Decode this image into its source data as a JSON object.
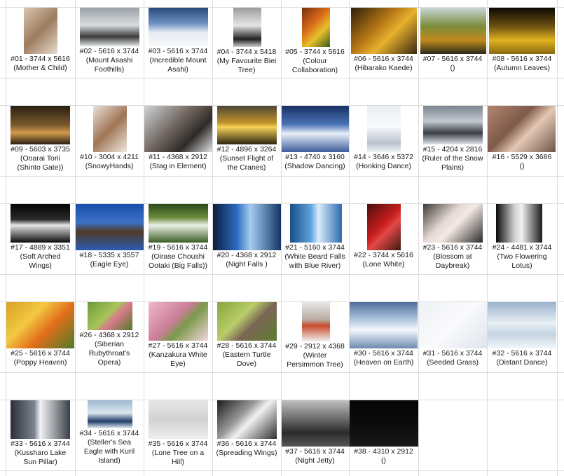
{
  "photos": [
    {
      "id": "01",
      "line1": "#01 - 3744 x 5616",
      "line2": "(Mother & Child)",
      "line3": "",
      "thumb": "photo-thumbnail-mother-child"
    },
    {
      "id": "02",
      "line1": "#02 - 5616 x 3744",
      "line2": "(Mount Asashi",
      "line3": "Foothills)",
      "thumb": "photo-thumbnail-mount-asashi-foothills"
    },
    {
      "id": "03",
      "line1": "#03 - 5616 x 3744",
      "line2": "(Incredible Mount",
      "line3": "Asahi)",
      "thumb": "photo-thumbnail-incredible-mount-asahi"
    },
    {
      "id": "04",
      "line1": "#04 - 3744 x 5418",
      "line2": "(My Favourite Biei",
      "line3": "Tree)",
      "thumb": "photo-thumbnail-biei-tree"
    },
    {
      "id": "05",
      "line1": "#05 - 3744 x 5616",
      "line2": "(Colour",
      "line3": "Collaboration)",
      "thumb": "photo-thumbnail-colour-collaboration"
    },
    {
      "id": "06",
      "line1": "#06 - 5616 x 3744",
      "line2": "(Hibarako Kaede)",
      "line3": "",
      "thumb": "photo-thumbnail-hibarako-kaede"
    },
    {
      "id": "07",
      "line1": "#07 - 5616 x 3744",
      "line2": "()",
      "line3": "",
      "thumb": "photo-thumbnail-07"
    },
    {
      "id": "08",
      "line1": "#08 - 5616 x 3744",
      "line2": "(Autumn Leaves)",
      "line3": "",
      "thumb": "photo-thumbnail-autumn-leaves"
    },
    {
      "id": "09",
      "line1": "#09 - 5603 x 3735",
      "line2": "(Ooarai Torii",
      "line3": "(Shinto Gate))",
      "thumb": "photo-thumbnail-ooarai-torii"
    },
    {
      "id": "10",
      "line1": "#10 - 3004 x 4211",
      "line2": "(SnowyHands)",
      "line3": "",
      "thumb": "photo-thumbnail-snowy-hands"
    },
    {
      "id": "11",
      "line1": "#11 - 4368 x 2912",
      "line2": "(Stag in Element)",
      "line3": "",
      "thumb": "photo-thumbnail-stag-in-element"
    },
    {
      "id": "12",
      "line1": "#12 - 4896 x 3264",
      "line2": "(Sunset Flight of",
      "line3": "the Cranes)",
      "thumb": "photo-thumbnail-sunset-flight-cranes"
    },
    {
      "id": "13",
      "line1": "#13 - 4740 x 3160",
      "line2": "(Shadow Dancing)",
      "line3": "",
      "thumb": "photo-thumbnail-shadow-dancing"
    },
    {
      "id": "14",
      "line1": "#14 - 3646 x 5372",
      "line2": "(Honking Dance)",
      "line3": "",
      "thumb": "photo-thumbnail-honking-dance"
    },
    {
      "id": "15",
      "line1": "#15 - 4204 x 2816",
      "line2": "(Ruler of the Snow",
      "line3": "Plains)",
      "thumb": "photo-thumbnail-ruler-of-snow-plains"
    },
    {
      "id": "16",
      "line1": "#16 - 5529 x 3686",
      "line2": "()",
      "line3": "",
      "thumb": "photo-thumbnail-16"
    },
    {
      "id": "17",
      "line1": "#17 - 4889 x 3351",
      "line2": "(Soft Arched",
      "line3": "Wings)",
      "thumb": "photo-thumbnail-soft-arched-wings"
    },
    {
      "id": "18",
      "line1": "#18 - 5335 x 3557",
      "line2": "(Eagle Eye)",
      "line3": "",
      "thumb": "photo-thumbnail-eagle-eye"
    },
    {
      "id": "19",
      "line1": "#19 - 5616 x 3744",
      "line2": "(Oirase Choushi",
      "line3": "Ootaki (Big Falls))",
      "thumb": "photo-thumbnail-oirase-choushi-ootaki"
    },
    {
      "id": "20",
      "line1": "#20 - 4368 x 2912",
      "line2": "(Night Falls )",
      "line3": "",
      "thumb": "photo-thumbnail-night-falls"
    },
    {
      "id": "21",
      "line1": "#21 - 5160 x 3744",
      "line2": "(White Beard Falls",
      "line3": "with Blue River)",
      "thumb": "photo-thumbnail-white-beard-falls"
    },
    {
      "id": "22",
      "line1": "#22 - 3744 x 5616",
      "line2": "(Lone White)",
      "line3": "",
      "thumb": "photo-thumbnail-lone-white"
    },
    {
      "id": "23",
      "line1": "#23 - 5616 x 3744",
      "line2": "(Blossom at",
      "line3": "Daybreak)",
      "thumb": "photo-thumbnail-blossom-at-daybreak"
    },
    {
      "id": "24",
      "line1": "#24 - 4481 x 3744",
      "line2": "(Two Flowering",
      "line3": "Lotus)",
      "thumb": "photo-thumbnail-two-flowering-lotus"
    },
    {
      "id": "25",
      "line1": "#25 - 5616 x 3744",
      "line2": "(Poppy Heaven)",
      "line3": "",
      "thumb": "photo-thumbnail-poppy-heaven"
    },
    {
      "id": "26",
      "line1": "#26 - 4368 x 2912",
      "line2": "(Siberian",
      "line3": "Rubythroat's",
      "line4": "Opera)",
      "thumb": "photo-thumbnail-siberian-rubythroat"
    },
    {
      "id": "27",
      "line1": "#27 - 5616 x 3744",
      "line2": "(Kanzakura White",
      "line3": "Eye)",
      "thumb": "photo-thumbnail-kanzakura-white-eye"
    },
    {
      "id": "28",
      "line1": "#28 - 5616 x 3744",
      "line2": "(Eastern Turtle",
      "line3": "Dove)",
      "thumb": "photo-thumbnail-eastern-turtle-dove"
    },
    {
      "id": "29",
      "line1": "#29 - 2912 x 4368",
      "line2": "(Winter",
      "line3": "Persimmon Tree)",
      "thumb": "photo-thumbnail-winter-persimmon-tree"
    },
    {
      "id": "30",
      "line1": "#30 - 5616 x 3744",
      "line2": "(Heaven on Earth)",
      "line3": "",
      "thumb": "photo-thumbnail-heaven-on-earth"
    },
    {
      "id": "31",
      "line1": "#31 - 5616 x 3744",
      "line2": "(Seeded Grass)",
      "line3": "",
      "thumb": "photo-thumbnail-seeded-grass"
    },
    {
      "id": "32",
      "line1": "#32 - 5616 x 3744",
      "line2": "(Distant Dance)",
      "line3": "",
      "thumb": "photo-thumbnail-distant-dance"
    },
    {
      "id": "33",
      "line1": "#33 - 5616 x 3744",
      "line2": "(Kussharo Lake",
      "line3": "Sun Pillar)",
      "thumb": "photo-thumbnail-kussharo-lake-sun-pillar"
    },
    {
      "id": "34",
      "line1": "#34 - 5616 x 3744",
      "line2": "(Steller's Sea",
      "line3": "Eagle with Kuril",
      "line4": "Island)",
      "thumb": "photo-thumbnail-stellers-sea-eagle"
    },
    {
      "id": "35",
      "line1": "#35 - 5616 x 3744",
      "line2": "(Lone Tree on a",
      "line3": "Hill)",
      "thumb": "photo-thumbnail-lone-tree-on-hill"
    },
    {
      "id": "36",
      "line1": "#36 - 5616 x 3744",
      "line2": "(Spreading Wings)",
      "line3": "",
      "thumb": "photo-thumbnail-spreading-wings"
    },
    {
      "id": "37",
      "line1": "#37 - 5616 x 3744",
      "line2": "(Night Jetty)",
      "line3": "",
      "thumb": "photo-thumbnail-night-jetty"
    },
    {
      "id": "38",
      "line1": "#38 - 4310 x 2912",
      "line2": "()",
      "line3": "",
      "thumb": "photo-thumbnail-38"
    }
  ]
}
